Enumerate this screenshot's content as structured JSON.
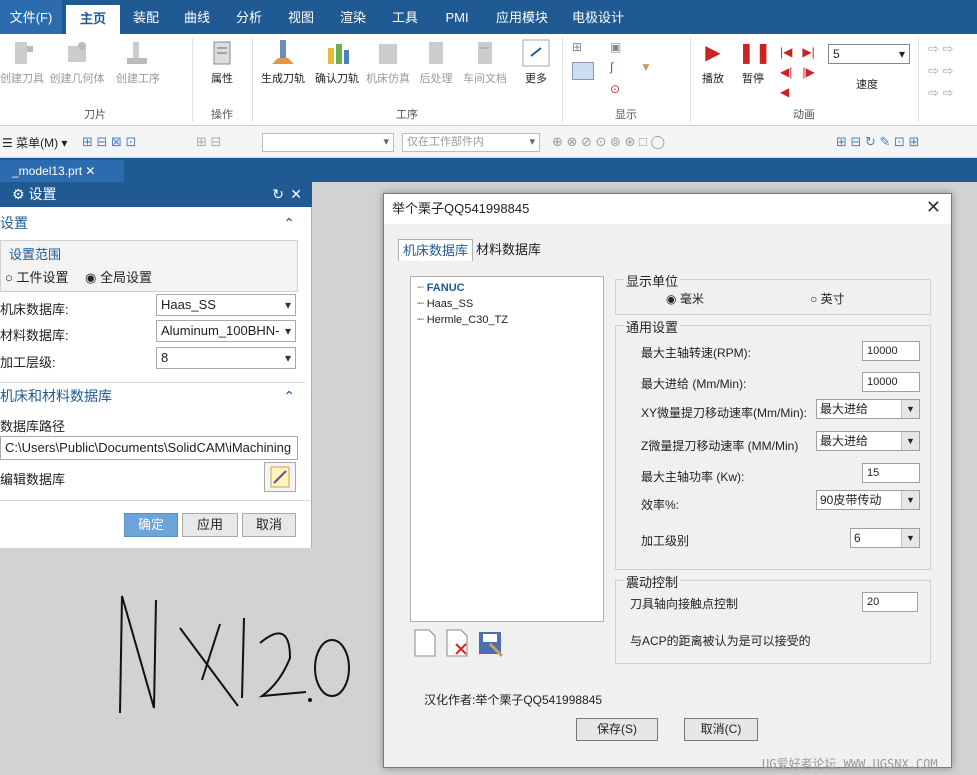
{
  "menubar": {
    "tabs": [
      "文件(F)",
      "主页",
      "装配",
      "曲线",
      "分析",
      "视图",
      "渲染",
      "工具",
      "PMI",
      "应用模块",
      "电极设计"
    ]
  },
  "ribbon": {
    "buttons": [
      "创建刀具",
      "创建几何体",
      "创建工序",
      "属性",
      "生成刀轨",
      "确认刀轨",
      "机床仿真",
      "后处理",
      "车间文档",
      "更多",
      "播放",
      "暂停",
      "速度"
    ],
    "groups": [
      "刀片",
      "操作",
      "工序",
      "显示",
      "动画"
    ],
    "speed_value": "5"
  },
  "toolbar2": {
    "menu_label": "菜单(M)",
    "filter_placeholder": "",
    "scope_value": "仅在工作部件内"
  },
  "doc_tab": "_model13.prt",
  "panel": {
    "title": "设置",
    "section1": "设置",
    "scope_label": "设置范围",
    "radio_work": "工件设置",
    "radio_global": "全局设置",
    "machine_db_label": "机床数据库:",
    "machine_db_value": "Haas_SS",
    "material_db_label": "材料数据库:",
    "material_db_value": "Aluminum_100BHN-",
    "level_label": "加工层级:",
    "level_value": "8",
    "section2": "机床和材料数据库",
    "db_path_label": "数据库路径",
    "db_path_value": "C:\\Users\\Public\\Documents\\SolidCAM\\iMachining",
    "edit_db_label": "编辑数据库",
    "ok": "确定",
    "apply": "应用",
    "cancel": "取消"
  },
  "handwriting": "NX12.0",
  "dialog": {
    "title": "举个栗子QQ541998845",
    "tabs": [
      "机床数据库",
      "材料数据库"
    ],
    "tree": [
      "FANUC",
      "Haas_SS",
      "Hermle_C30_TZ"
    ],
    "units_group": "显示单位",
    "unit_mm": "毫米",
    "unit_inch": "英寸",
    "general_group": "通用设置",
    "max_spindle_label": "最大主轴转速(RPM):",
    "max_spindle_value": "10000",
    "max_feed_label": "最大进给 (Mm/Min):",
    "max_feed_value": "10000",
    "xy_rate_label": "XY微量提刀移动速率(Mm/Min):",
    "xy_rate_value": "最大进给",
    "z_rate_label": "Z微量提刀移动速率 (MM/Min)",
    "z_rate_value": "最大进给",
    "spindle_power_label": "最大主轴功率 (Kw):",
    "spindle_power_value": "15",
    "efficiency_label": "效率%:",
    "efficiency_value": "90皮带传动",
    "level_label": "加工级别",
    "level_value": "6",
    "vibration_group": "震动控制",
    "tool_axis_label": "刀具轴向接触点控制",
    "tool_axis_value": "20",
    "acp_note": "与ACP的距离被认为是可以接受的",
    "translator": "汉化作者:举个栗子QQ541998845",
    "save": "保存(S)",
    "cancel": "取消(C)"
  },
  "watermark": "UG爱好者论坛 WWW.UGSNX.COM"
}
